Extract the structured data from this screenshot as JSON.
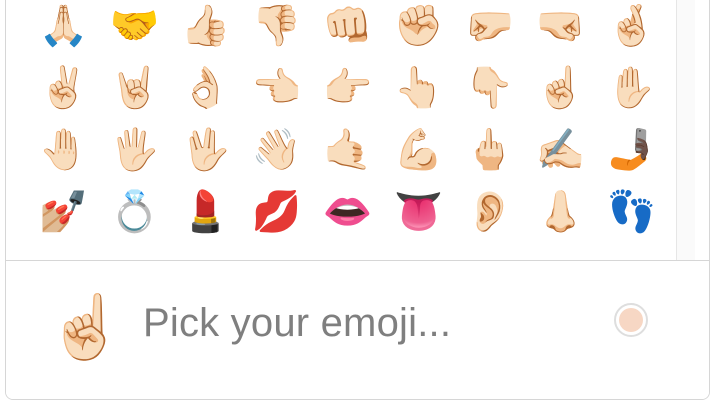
{
  "emoji_grid": [
    [
      "🙏🏻",
      "🤝",
      "👍🏻",
      "👎🏻",
      "👊🏻",
      "✊🏻",
      "🤛🏻",
      "🤜🏻",
      "🤞🏻"
    ],
    [
      "✌🏻",
      "🤘🏻",
      "👌🏻",
      "👈🏻",
      "👉🏻",
      "👆🏻",
      "👇🏻",
      "☝🏻",
      "✋🏻"
    ],
    [
      "🤚🏻",
      "🖐🏻",
      "🖖🏻",
      "👋🏻",
      "🤙🏻",
      "💪🏻",
      "🖕🏻",
      "✍🏻",
      "🤳🏿"
    ],
    [
      "💅🏼",
      "💍",
      "💄",
      "💋",
      "👄",
      "👅",
      "👂🏻",
      "👃🏻",
      "👣"
    ]
  ],
  "footer": {
    "preview_emoji": "☝🏻",
    "placeholder": "Pick your emoji...",
    "skin_tone_color": "#f7d7c4"
  }
}
